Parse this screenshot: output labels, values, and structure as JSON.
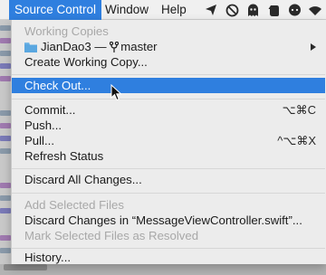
{
  "menubar": {
    "menus": [
      {
        "label": "Source Control"
      },
      {
        "label": "Window"
      },
      {
        "label": "Help"
      }
    ],
    "status_icons": [
      "send-icon",
      "no-entry-icon",
      "ghost-icon",
      "evernote-icon",
      "chat-bubble-icon",
      "wifi-icon"
    ]
  },
  "dropdown": {
    "working_copies_header": "Working Copies",
    "repo_entry": {
      "repo": "JianDao3",
      "separator": "—",
      "branch": "master"
    },
    "create_working_copy": "Create Working Copy...",
    "check_out": "Check Out...",
    "commit": {
      "label": "Commit...",
      "shortcut": "⌥⌘C"
    },
    "push": "Push...",
    "pull": {
      "label": "Pull...",
      "shortcut": "^⌥⌘X"
    },
    "refresh_status": "Refresh Status",
    "discard_all": "Discard All Changes...",
    "add_selected": "Add Selected Files",
    "discard_in_file": "Discard Changes in “MessageViewController.swift”...",
    "mark_resolved": "Mark Selected Files as Resolved",
    "history": "History..."
  },
  "colors": {
    "accent": "#2f7fdf",
    "menu_bg": "#ececec",
    "disabled_text": "#a8a8a8"
  }
}
